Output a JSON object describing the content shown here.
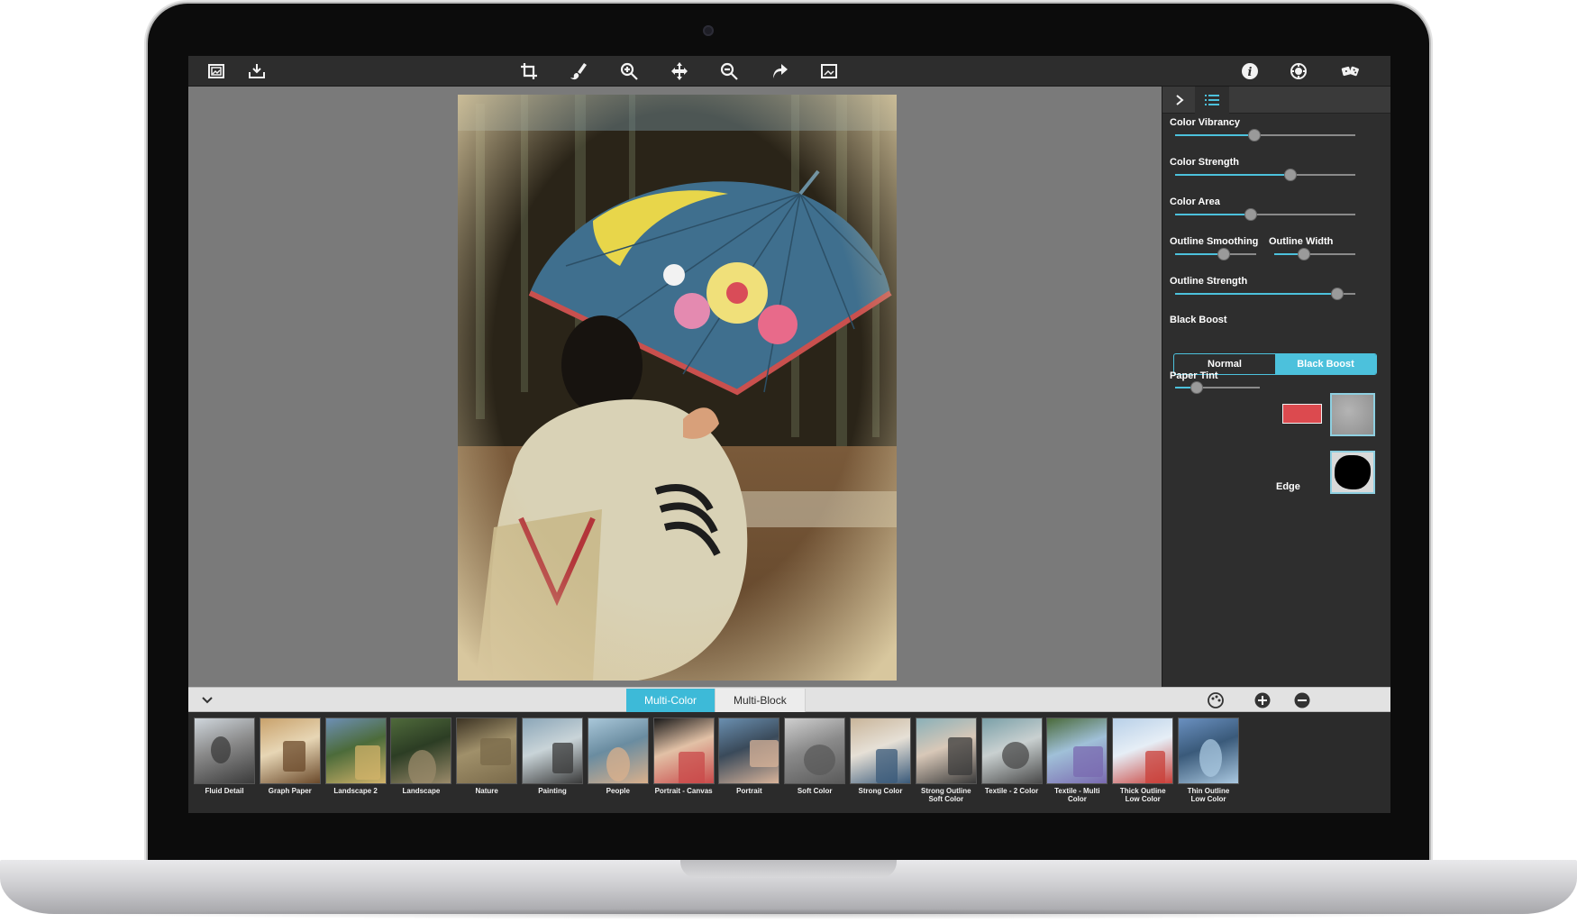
{
  "toolbar": {
    "left_icons": [
      "open-image-icon",
      "save-image-icon"
    ],
    "center_icons": [
      "crop-icon",
      "brush-icon",
      "zoom-in-icon",
      "pan-icon",
      "zoom-out-icon",
      "redo-icon",
      "fit-image-icon"
    ],
    "right_icons": [
      "info-icon",
      "settings-icon",
      "presets-icon"
    ]
  },
  "panel": {
    "tabs": [
      "collapse-panel-icon",
      "list-icon"
    ],
    "color_vibrancy": {
      "label": "Color Vibrancy",
      "value": 0.44
    },
    "color_strength": {
      "label": "Color Strength",
      "value": 0.64
    },
    "color_area": {
      "label": "Color Area",
      "value": 0.42
    },
    "outline_smoothing": {
      "label": "Outline Smoothing",
      "value": 0.6
    },
    "outline_width": {
      "label": "Outline Width",
      "value": 0.37
    },
    "outline_strength": {
      "label": "Outline Strength",
      "value": 0.9
    },
    "black_boost": {
      "label": "Black Boost",
      "options": [
        "Normal",
        "Black Boost"
      ],
      "selected": "Black Boost"
    },
    "paper_tint": {
      "label": "Paper Tint",
      "value": 0.25,
      "tint_color": "#dc4a4f"
    },
    "edge": {
      "label": "Edge"
    }
  },
  "categories": {
    "tabs": [
      "Multi-Color",
      "Multi-Block"
    ],
    "selected": "Multi-Color"
  },
  "presets": [
    "Fluid Detail",
    "Graph Paper",
    "Landscape 2",
    "Landscape",
    "Nature",
    "Painting",
    "People",
    "Portrait - Canvas",
    "Portrait",
    "Soft Color",
    "Strong Color",
    "Strong Outline\nSoft Color",
    "Textile - 2 Color",
    "Textile - Multi\nColor",
    "Thick Outline\nLow Color",
    "Thin Outline\nLow Color"
  ],
  "colors": {
    "accent": "#3dbad8",
    "toolbar_bg": "#2d2d2d",
    "canvas_bg": "#7a7a7a",
    "panel_bg": "#2e2e2e"
  }
}
